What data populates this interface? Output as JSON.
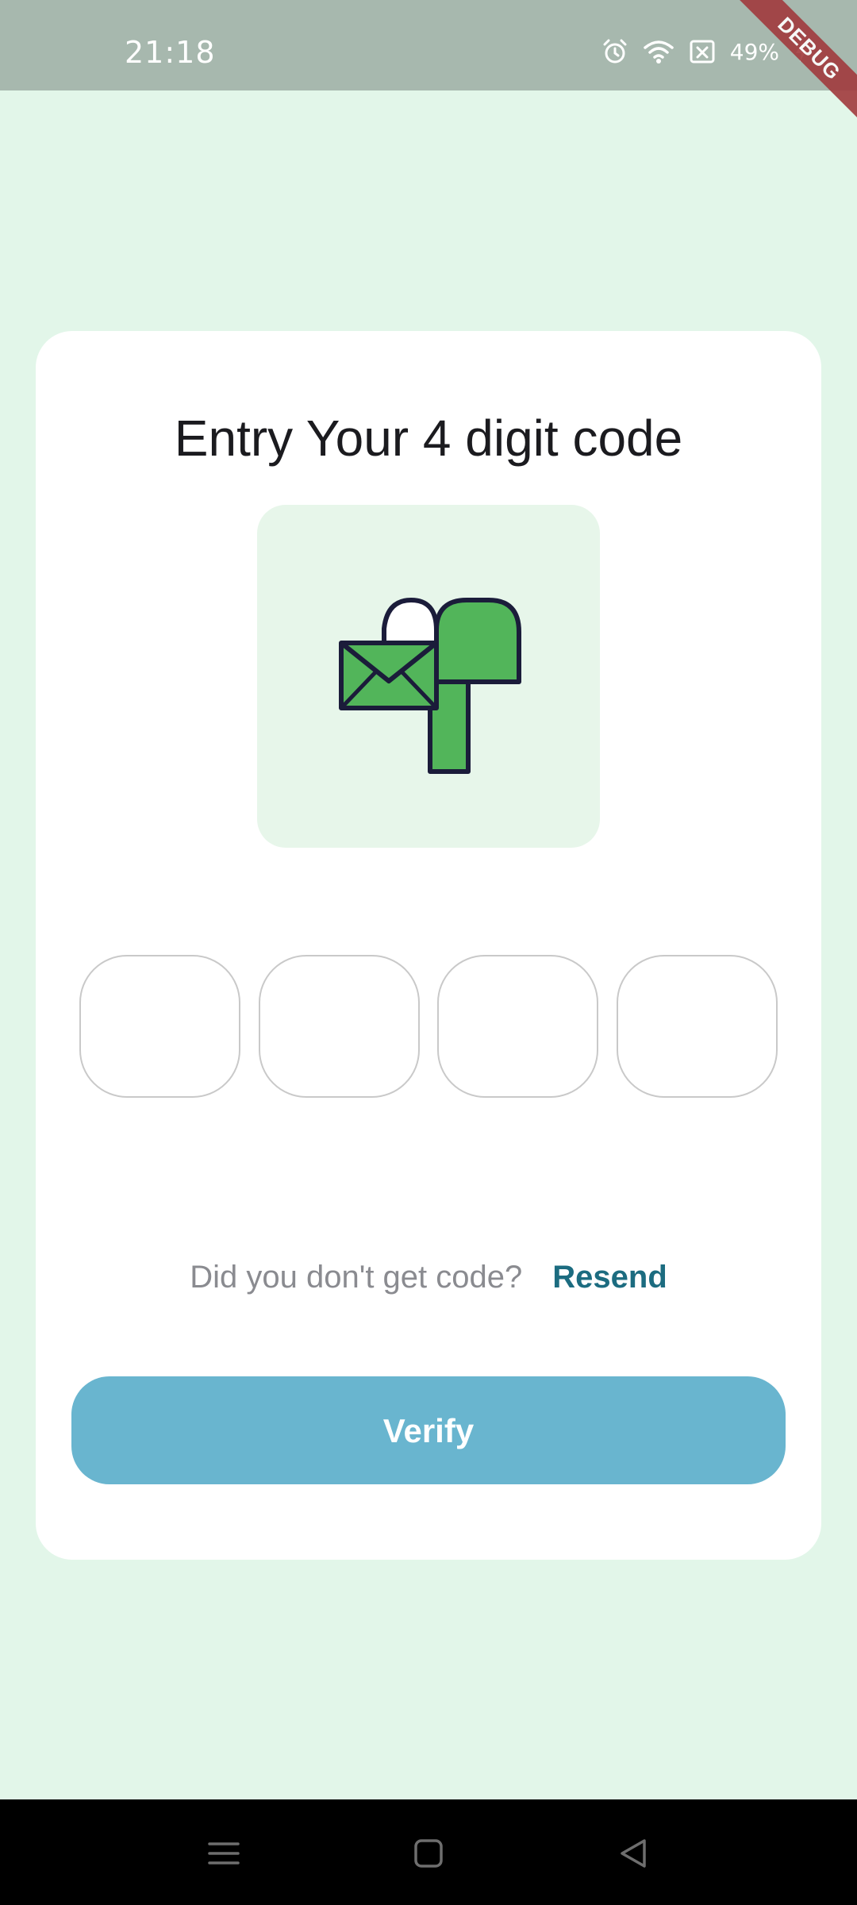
{
  "status_bar": {
    "time": "21:18",
    "battery": "49%",
    "icons": [
      "alarm-icon",
      "wifi-icon",
      "sim-icon",
      "battery-charging-icon"
    ]
  },
  "debug_banner": "DEBUG",
  "card": {
    "title": "Entry Your 4 digit code",
    "illustration_icon": "mailbox-with-envelope-icon",
    "code_fields": [
      {
        "value": ""
      },
      {
        "value": ""
      },
      {
        "value": ""
      },
      {
        "value": ""
      }
    ],
    "resend_question": "Did you don't get code?",
    "resend_label": "Resend",
    "verify_label": "Verify"
  },
  "nav_bar": {
    "icons": [
      "menu-icon",
      "home-icon",
      "back-icon"
    ]
  },
  "colors": {
    "background": "#e2f6e9",
    "status_bar": "#a7b8ae",
    "accent_green": "#52b55a",
    "outline_navy": "#1b1c3a",
    "link": "#1c6c80",
    "button": "#69b5cf",
    "debug_banner": "#a13a3d"
  }
}
